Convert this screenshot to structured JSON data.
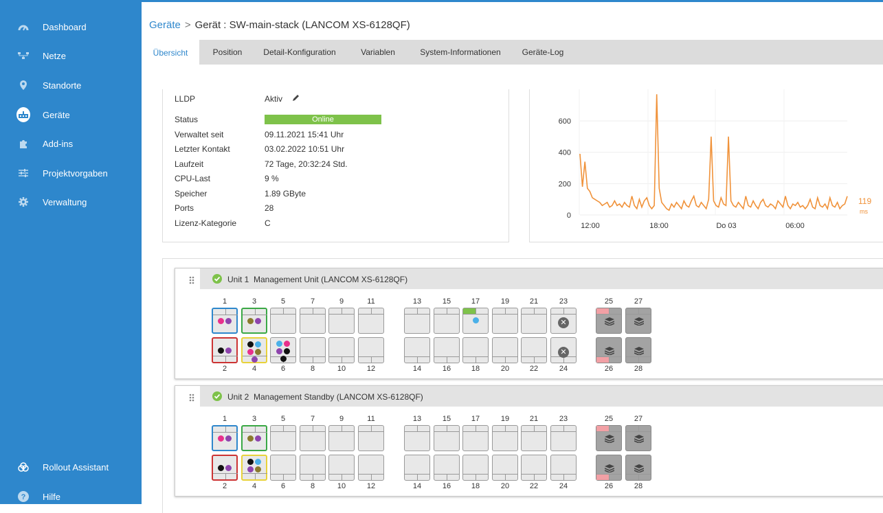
{
  "sidebar": {
    "items": [
      {
        "label": "Dashboard",
        "icon": "dashboard-icon"
      },
      {
        "label": "Netze",
        "icon": "network-icon"
      },
      {
        "label": "Standorte",
        "icon": "location-pin-icon"
      },
      {
        "label": "Geräte",
        "icon": "device-icon",
        "active": true
      },
      {
        "label": "Add-ins",
        "icon": "puzzle-icon"
      },
      {
        "label": "Projektvorgaben",
        "icon": "sliders-icon"
      },
      {
        "label": "Verwaltung",
        "icon": "gear-icon"
      }
    ],
    "bottom": [
      {
        "label": "Rollout Assistant",
        "icon": "rollout-icon"
      },
      {
        "label": "Hilfe",
        "icon": "help-icon"
      }
    ]
  },
  "breadcrumb": {
    "parent": "Geräte",
    "separator": ">",
    "current": "Gerät : SW-main-stack (LANCOM XS-6128QF)"
  },
  "tabs": [
    "Übersicht",
    "Position",
    "Detail-Konfiguration",
    "Variablen",
    "System-Informationen",
    "Geräte-Log"
  ],
  "info": {
    "lldp_label": "LLDP",
    "lldp_value": "Aktiv",
    "rows": [
      {
        "label": "Status",
        "value": "Online"
      },
      {
        "label": "Verwaltet seit",
        "value": "09.11.2021 15:41 Uhr"
      },
      {
        "label": "Letzter Kontakt",
        "value": "03.02.2022 10:51 Uhr"
      },
      {
        "label": "Laufzeit",
        "value": "72 Tage, 20:32:24 Std."
      },
      {
        "label": "CPU-Last",
        "value": "9 %"
      },
      {
        "label": "Speicher",
        "value": "1.89 GByte"
      },
      {
        "label": "Ports",
        "value": "28"
      },
      {
        "label": "Lizenz-Kategorie",
        "value": "C"
      }
    ]
  },
  "chart_data": {
    "type": "line",
    "x_ticks": [
      "12:00",
      "18:00",
      "Do 03",
      "06:00"
    ],
    "y_ticks": [
      "0",
      "200",
      "400",
      "600"
    ],
    "ylim": [
      0,
      780
    ],
    "current_value": "119",
    "current_unit": "ms",
    "line_color": "#f0923a",
    "series": [
      {
        "values": [
          390,
          180,
          340,
          170,
          150,
          110,
          100,
          90,
          80,
          60,
          70,
          80,
          50,
          60,
          90,
          60,
          70,
          50,
          80,
          60,
          50,
          120,
          60,
          40,
          100,
          50,
          90,
          110,
          60,
          40,
          60,
          770,
          170,
          80,
          60,
          40,
          30,
          70,
          50,
          80,
          60,
          40,
          90,
          60,
          50,
          90,
          120,
          60,
          50,
          80,
          60,
          40,
          100,
          500,
          90,
          60,
          50,
          110,
          70,
          60,
          500,
          90,
          60,
          50,
          80,
          60,
          40,
          120,
          60,
          50,
          90,
          60,
          40,
          80,
          100,
          60,
          50,
          70,
          60,
          40,
          90,
          70,
          50,
          120,
          60,
          40,
          70,
          60,
          80,
          50,
          60,
          40,
          60,
          100,
          50,
          40,
          110,
          60,
          50,
          70,
          40,
          110,
          60,
          50,
          80,
          40,
          60,
          70,
          119
        ]
      }
    ]
  },
  "units": [
    {
      "title": "Unit 1  Management Unit (LANCOM XS-6128QF)",
      "top_nums": [
        "1",
        "3",
        "5",
        "7",
        "9",
        "11",
        "13",
        "15",
        "17",
        "19",
        "21",
        "23",
        "25",
        "27"
      ],
      "bottom_nums": [
        "2",
        "4",
        "6",
        "8",
        "10",
        "12",
        "14",
        "16",
        "18",
        "20",
        "22",
        "24",
        "26",
        "28"
      ]
    },
    {
      "title": "Unit 2  Management Standby (LANCOM XS-6128QF)",
      "top_nums": [
        "1",
        "3",
        "5",
        "7",
        "9",
        "11",
        "13",
        "15",
        "17",
        "19",
        "21",
        "23",
        "25",
        "27"
      ],
      "bottom_nums": [
        "2",
        "4",
        "6",
        "8",
        "10",
        "12",
        "14",
        "16",
        "18",
        "20",
        "22",
        "24",
        "26",
        "28"
      ]
    }
  ],
  "colors": {
    "accent": "#2e87cc",
    "online": "#7ec24a",
    "sfp_alert": "#f2a0a5"
  }
}
